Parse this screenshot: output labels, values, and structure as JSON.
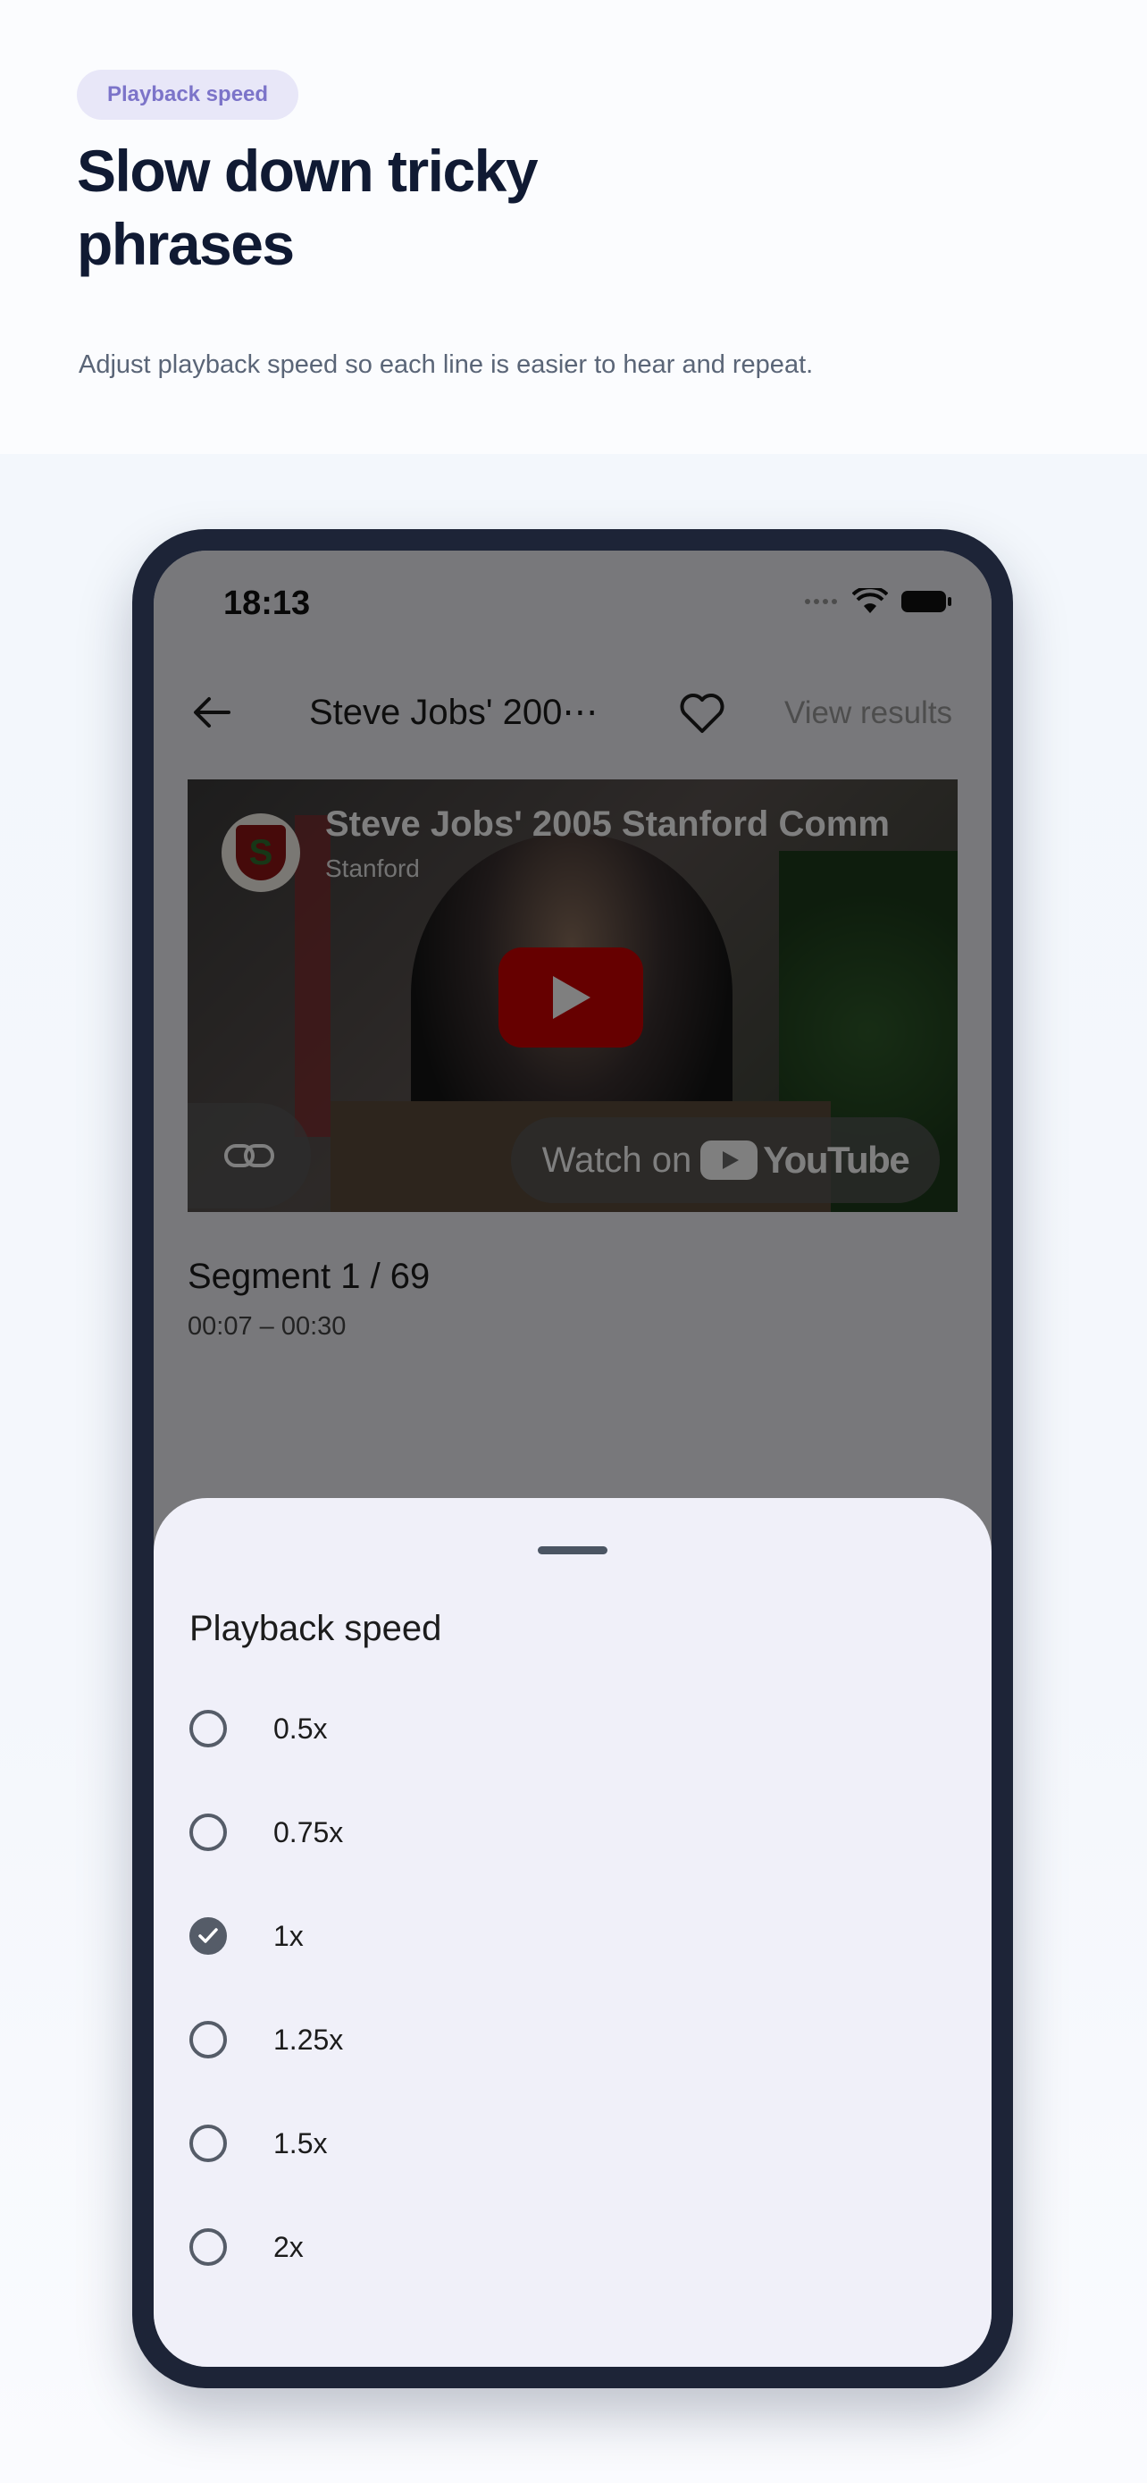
{
  "header": {
    "badge": "Playback speed",
    "title": "Slow down tricky phrases",
    "subtitle": "Adjust playback speed so each line is easier to hear and repeat."
  },
  "status_bar": {
    "time": "18:13"
  },
  "app_bar": {
    "title": "Steve Jobs' 200⋯",
    "view_results": "View results"
  },
  "video": {
    "title": "Steve Jobs' 2005 Stanford Comm",
    "channel": "Stanford",
    "avatar_letter": "S",
    "watch_on": "Watch on",
    "youtube_text": "YouTube"
  },
  "segment": {
    "title": "Segment 1 / 69",
    "time": "00:07 – 00:30"
  },
  "sheet": {
    "title": "Playback speed",
    "options": [
      {
        "label": "0.5x",
        "selected": false
      },
      {
        "label": "0.75x",
        "selected": false
      },
      {
        "label": "1x",
        "selected": true
      },
      {
        "label": "1.25x",
        "selected": false
      },
      {
        "label": "1.5x",
        "selected": false
      },
      {
        "label": "2x",
        "selected": false
      }
    ]
  },
  "colors": {
    "badge_bg": "#e8e7f8",
    "badge_text": "#7c74c9",
    "headline": "#101a33",
    "phone_frame": "#1d2437",
    "youtube_red": "#cc0000"
  }
}
